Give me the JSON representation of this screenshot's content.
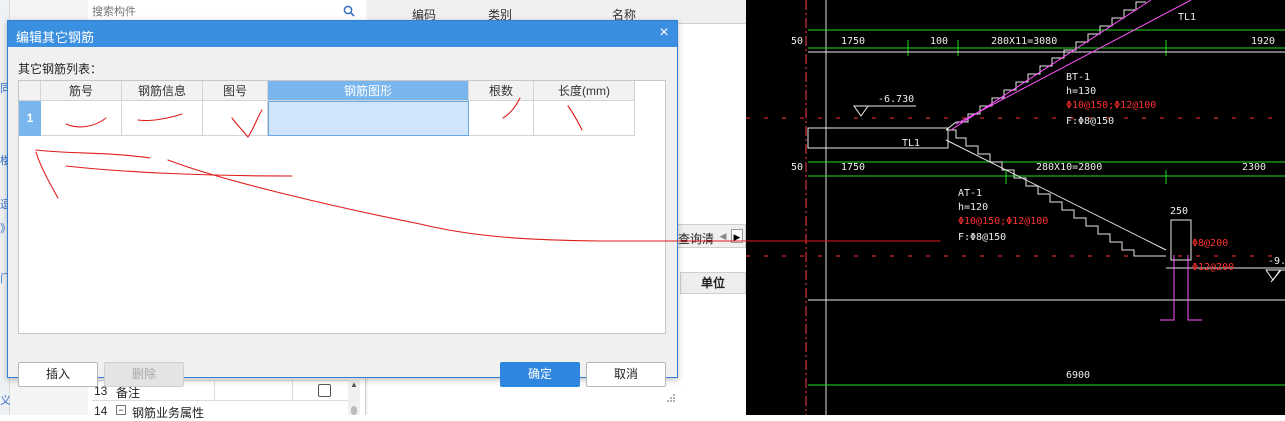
{
  "background_app": {
    "search_placeholder": "搜索构件",
    "list_columns": [
      "编码",
      "类别",
      "名称"
    ],
    "tab_label": "查询清",
    "unit_header": "单位",
    "left_strip_glyphs": [
      "同",
      "楼",
      "逗",
      "》",
      "门",
      "义"
    ],
    "property_rows": [
      {
        "num": "13",
        "label": "备注",
        "checkbox": true
      },
      {
        "num": "14",
        "label": "钢筋业务属性",
        "expander": "−"
      }
    ]
  },
  "dialog": {
    "title": "编辑其它钢筋",
    "close_glyph": "×",
    "list_label": "其它钢筋列表：",
    "columns": [
      "筋号",
      "钢筋信息",
      "图号",
      "钢筋图形",
      "根数",
      "长度(mm)"
    ],
    "active_column": "钢筋图形",
    "row_number": "1",
    "buttons": {
      "insert": "插入",
      "delete": "删除",
      "ok": "确定",
      "cancel": "取消"
    }
  },
  "cad": {
    "labels": {
      "dim_50_top": "50",
      "dim_1750_top": "1750",
      "dim_100": "100",
      "dim_280x11": "280X11=3080",
      "dim_1920": "1920",
      "tl1_top": "TL1",
      "elev_673": "-6.730",
      "bt1": "BT-1",
      "bt1_h": "h=130",
      "bt1_rebar": "Φ10@150;Φ12@100",
      "bt1_f": "F:Φ8@150",
      "tl1_mid": "TL1",
      "dim_50_mid": "50",
      "dim_1750_mid": "1750",
      "dim_280x10": "280X10=2800",
      "dim_2300": "2300",
      "at1": "AT-1",
      "at1_h": "h=120",
      "at1_rebar": "Φ10@150;Φ12@100",
      "at1_f": "F:Φ8@150",
      "dim_250": "250",
      "rebar_8_200": "Φ8@200",
      "rebar_12_200": "Φ12@200",
      "elev_9": "-9.",
      "dim_6900": "6900"
    }
  },
  "colors": {
    "dialog_title_bg": "#3b8fe0",
    "active_column": "#7ab6ee",
    "primary_button": "#2f86e0",
    "cad_bg": "#000000",
    "cad_green": "#22dd22",
    "cad_magenta": "#ff55ff",
    "cad_red": "#ff2020",
    "annotation_red": "#e11c1c"
  }
}
